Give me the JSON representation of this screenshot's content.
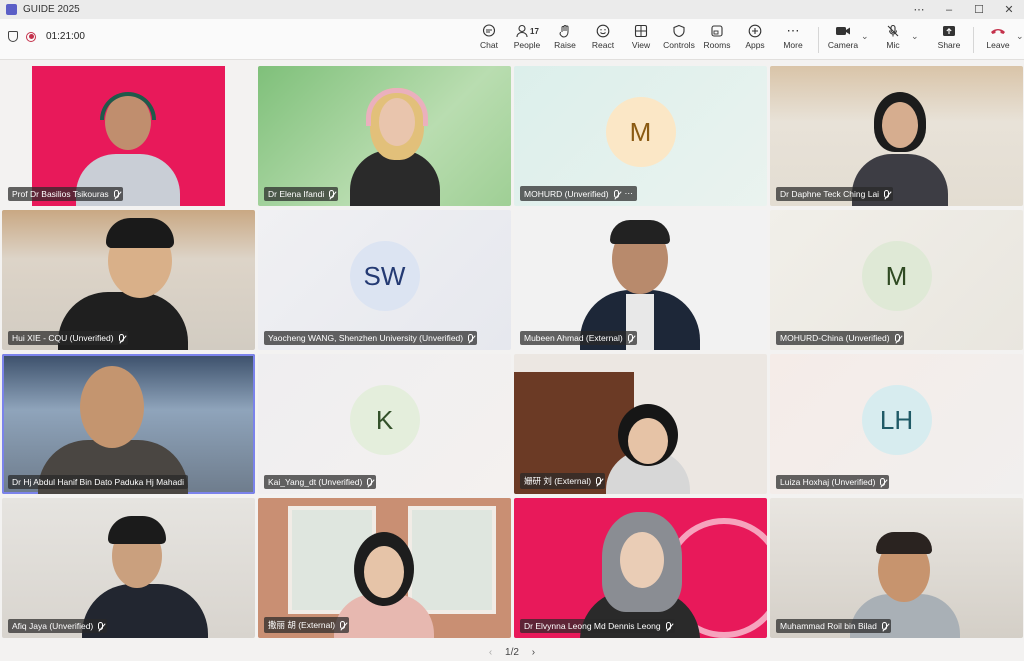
{
  "window": {
    "title": "GUIDE 2025"
  },
  "toolbar": {
    "timer": "01:21:00",
    "chat": "Chat",
    "people": "People",
    "people_count": "17",
    "raise": "Raise",
    "react": "React",
    "view": "View",
    "controls": "Controls",
    "rooms": "Rooms",
    "apps": "Apps",
    "more": "More",
    "camera": "Camera",
    "mic": "Mic",
    "share": "Share",
    "leave": "Leave"
  },
  "tiles": [
    {
      "name": "Prof Dr Basilios Tsikouras"
    },
    {
      "name": "Dr Elena Ifandi"
    },
    {
      "name": "MOHURD (Unverified)",
      "initials": "M"
    },
    {
      "name": "Dr Daphne Teck Ching Lai"
    },
    {
      "name": "Hui XIE - CQU (Unverified)"
    },
    {
      "name": "Yaocheng WANG, Shenzhen University (Unverified)",
      "initials": "SW"
    },
    {
      "name": "Mubeen Ahmad (External)"
    },
    {
      "name": "MOHURD-China (Unverified)",
      "initials": "M"
    },
    {
      "name": "Dr Hj Abdul Hanif Bin Dato Paduka Hj Mahadi"
    },
    {
      "name": "Kai_Yang_dt (Unverified)",
      "initials": "K"
    },
    {
      "name": "姗研 刘 (External)"
    },
    {
      "name": "Luiza Hoxhaj (Unverified)",
      "initials": "LH"
    },
    {
      "name": "Afiq Jaya (Unverified)"
    },
    {
      "name": "撒丽 胡 (External)"
    },
    {
      "name": "Dr Elvynna Leong Md Dennis Leong"
    },
    {
      "name": "Muhammad Roil bin Bilad"
    }
  ],
  "pager": {
    "label": "1/2"
  },
  "colors": {
    "accent": "#5b5fc7",
    "leave": "#c4314b",
    "selected_border": "#7b83eb"
  }
}
